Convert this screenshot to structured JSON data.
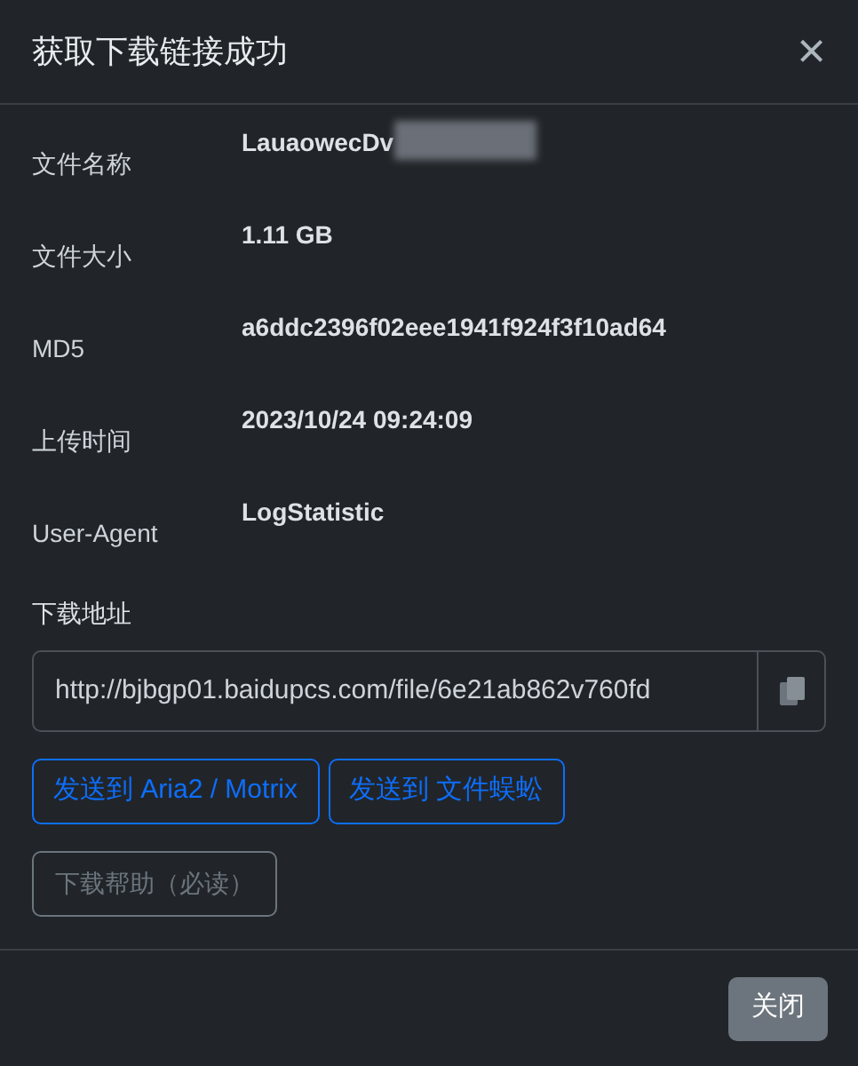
{
  "dialog": {
    "title": "获取下载链接成功",
    "close_icon": "×"
  },
  "fields": [
    {
      "label": "文件名称",
      "value": "LauaowecDv",
      "redacted": true
    },
    {
      "label": "文件大小",
      "value": "1.11 GB",
      "redacted": false
    },
    {
      "label": "MD5",
      "value": "a6ddc2396f02eee1941f924f3f10ad64",
      "redacted": false
    },
    {
      "label": "上传时间",
      "value": "2023/10/24 09:24:09",
      "redacted": false
    },
    {
      "label": "User-Agent",
      "value": "LogStatistic",
      "redacted": false
    }
  ],
  "download": {
    "label": "下载地址",
    "url": "http://bjbgp01.baidupcs.com/file/6e21ab862v760fd"
  },
  "actions": [
    {
      "label": "发送到 Aria2 / Motrix",
      "kind": "primary"
    },
    {
      "label": "发送到 文件蜈蚣",
      "kind": "primary"
    }
  ],
  "help_button": {
    "label": "下载帮助（必读）"
  },
  "footer": {
    "close_button": "关闭"
  }
}
